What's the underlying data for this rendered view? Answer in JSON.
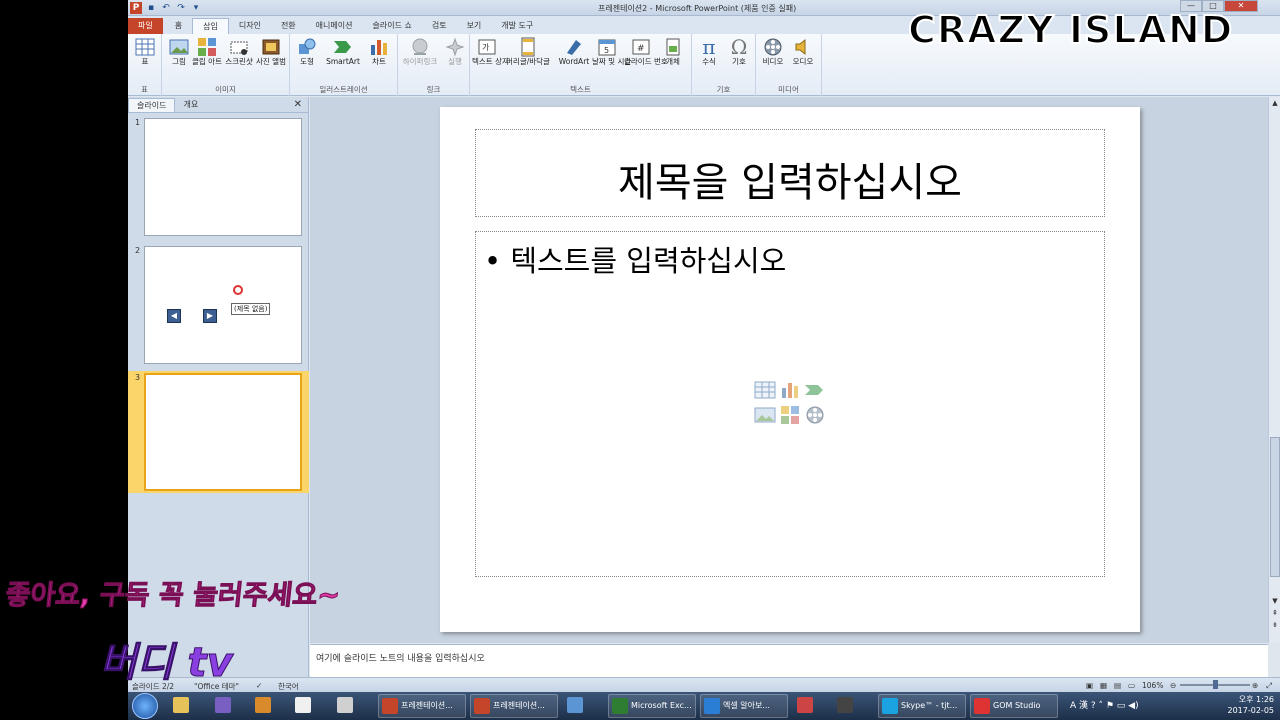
{
  "window": {
    "title": "프레젠테이션2 - Microsoft PowerPoint (제품 인증 실패)"
  },
  "ribbon_tabs": [
    {
      "label": "파일"
    },
    {
      "label": "홈"
    },
    {
      "label": "삽입"
    },
    {
      "label": "디자인"
    },
    {
      "label": "전환"
    },
    {
      "label": "애니메이션"
    },
    {
      "label": "슬라이드 쇼"
    },
    {
      "label": "검토"
    },
    {
      "label": "보기"
    },
    {
      "label": "개발 도구"
    }
  ],
  "ribbon": {
    "table_group": {
      "label": "표",
      "btn_table": "표"
    },
    "image_group": {
      "label": "이미지",
      "btn_picture": "그림",
      "btn_clipart": "클립 아트",
      "btn_screenshot": "스크린샷",
      "btn_album": "사진 앨범"
    },
    "illus_group": {
      "label": "일러스트레이션",
      "btn_shapes": "도형",
      "btn_smartart": "SmartArt",
      "btn_chart": "차트"
    },
    "link_group": {
      "label": "링크",
      "btn_hyperlink": "하이퍼링크",
      "btn_action": "실행"
    },
    "text_group": {
      "label": "텍스트",
      "btn_textbox": "텍스트 상자",
      "btn_header": "머리글/바닥글",
      "btn_wordart": "WordArt",
      "btn_datetime": "날짜 및 시간",
      "btn_slidenum": "슬라이드 번호",
      "btn_object": "개체"
    },
    "symbol_group": {
      "label": "기호",
      "btn_equation": "수식",
      "btn_symbol": "기호"
    },
    "media_group": {
      "label": "미디어",
      "btn_video": "비디오",
      "btn_audio": "오디오"
    }
  },
  "slides_panel": {
    "tab_slides": "슬라이드",
    "tab_outline": "개요",
    "thumbnails": [
      {
        "number": "1"
      },
      {
        "number": "2"
      },
      {
        "number": "3"
      }
    ],
    "tooltip": "(제목 없음)"
  },
  "slide": {
    "title_placeholder": "제목을 입력하십시오",
    "body_placeholder": "• 텍스트를 입력하십시오"
  },
  "notes": {
    "placeholder": "여기에 슬라이드 노트의 내용을 입력하십시오"
  },
  "status": {
    "slide_count": "슬라이드 2/2",
    "theme": "\"Office 테마\"",
    "language": "한국어",
    "zoom": "106%"
  },
  "taskbar": {
    "items": [
      {
        "label": "프레젠테이션..."
      },
      {
        "label": "프레젠테이션..."
      },
      {
        "label": "Microsoft Exc..."
      },
      {
        "label": "엑셀 알아보..."
      },
      {
        "label": "Skype™ - tjt..."
      },
      {
        "label": "GOM Studio"
      }
    ],
    "time": "오후 1:26",
    "date": "2017-02-05"
  },
  "overlays": {
    "watermark": "CRAZY ISLAND",
    "subscribe": "좋아요, 구독 꼭 눌러주세요~",
    "channel": "버디 tv"
  },
  "colors": {
    "accent": "#c4452a",
    "selected_slide": "#fbd46a",
    "ribbon_bg": "#e4ecf6"
  }
}
